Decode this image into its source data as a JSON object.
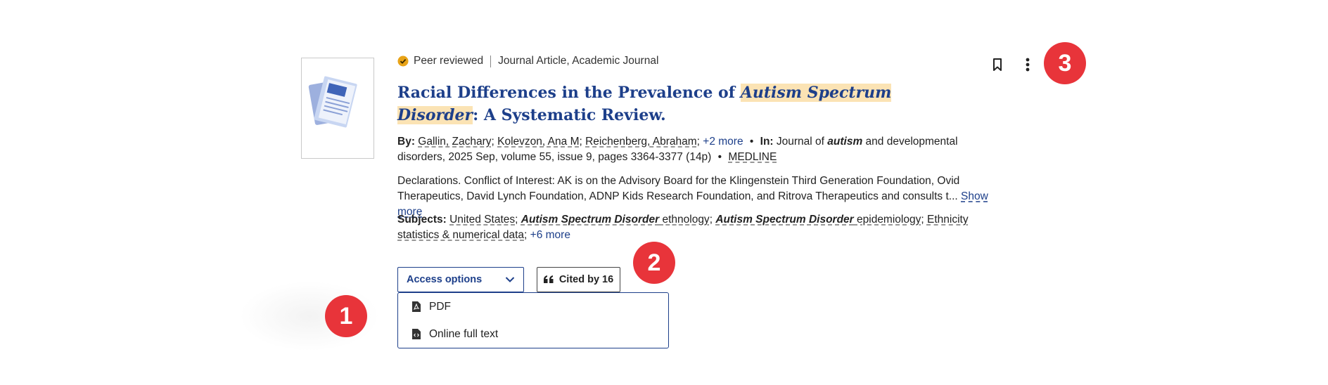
{
  "result": {
    "meta": {
      "peer_reviewed": "Peer reviewed",
      "type": "Journal Article, Academic Journal"
    },
    "title": {
      "part1": "Racial Differences in the Prevalence of ",
      "highlight": "Autism Spectrum Disorder",
      "part2": ": A Systematic Review."
    },
    "byline": {
      "by_label": "By:",
      "authors": [
        "Gallin, Zachary",
        "Kolevzon, Ana M",
        "Reichenberg, Abraham"
      ],
      "more_authors": "+2 more",
      "in_label": "In:",
      "journal_pre": "Journal of ",
      "journal_em": "autism",
      "journal_post": " and developmental disorders, 2025 Sep, volume 55, issue 9, pages 3364-3377 (14p)",
      "database": "MEDLINE"
    },
    "abstract": {
      "text": "Declarations. Conflict of Interest: AK is on the Advisory Board for the Klingenstein Third Generation Foundation, Ovid Therapeutics, David Lynch Foundation, ADNP Kids Research Foundation, and Ritrova Therapeutics and consults t...",
      "show_more": "Show more"
    },
    "subjects": {
      "label": "Subjects:",
      "s1": "United States",
      "s2_em": "Autism Spectrum Disorder",
      "s2_rest": " ethnology",
      "s3_em": "Autism Spectrum Disorder",
      "s3_rest": " epidemiology",
      "s4": "Ethnicity statistics & numerical data",
      "more": "+6 more"
    },
    "buttons": {
      "access_options": "Access options",
      "cited_by": "Cited by 16"
    },
    "access_menu": [
      {
        "label": "PDF",
        "icon": "pdf-file-icon"
      },
      {
        "label": "Online full text",
        "icon": "html-file-icon"
      }
    ]
  },
  "annotations": {
    "badge1": "1",
    "badge2": "2",
    "badge3": "3"
  },
  "colors": {
    "title": "#1d3f8a",
    "highlight": "#fbe3b4",
    "badge": "#e8343a",
    "peer_badge": "#e8a317"
  }
}
